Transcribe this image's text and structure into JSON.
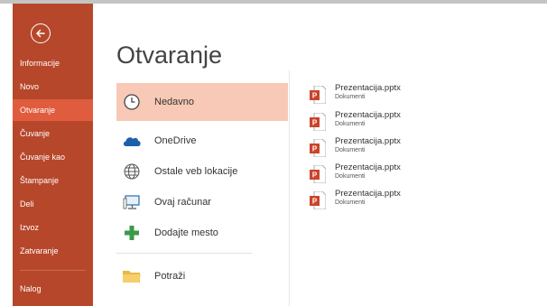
{
  "sidebar": {
    "items": [
      {
        "label": "Informacije"
      },
      {
        "label": "Novo"
      },
      {
        "label": "Otvaranje"
      },
      {
        "label": "Čuvanje"
      },
      {
        "label": "Čuvanje kao"
      },
      {
        "label": "Štampanje"
      },
      {
        "label": "Deli"
      },
      {
        "label": "Izvoz"
      },
      {
        "label": "Zatvaranje"
      },
      {
        "label": "Nalog"
      }
    ],
    "active_item": "Otvaranje",
    "color": "#b7472a",
    "active_color": "#e05c3e"
  },
  "main": {
    "title": "Otvaranje",
    "locations": [
      {
        "label": "Nedavno",
        "icon": "clock-icon"
      },
      {
        "label": "OneDrive",
        "icon": "onedrive-cloud-icon"
      },
      {
        "label": "Ostale veb lokacije",
        "icon": "globe-icon"
      },
      {
        "label": "Ovaj računar",
        "icon": "computer-icon"
      },
      {
        "label": "Dodajte mesto",
        "icon": "plus-icon"
      },
      {
        "label": "Potraži",
        "icon": "folder-icon"
      }
    ],
    "selected_location": "Nedavno",
    "selected_color": "#f8c9b6"
  },
  "recent_files": [
    {
      "name": "Prezentacija.pptx",
      "location": "Dokumenti"
    },
    {
      "name": "Prezentacija.pptx",
      "location": "Dokumenti"
    },
    {
      "name": "Prezentacija.pptx",
      "location": "Dokumenti"
    },
    {
      "name": "Prezentacija.pptx",
      "location": "Dokumenti"
    },
    {
      "name": "Prezentacija.pptx",
      "location": "Dokumenti"
    }
  ]
}
